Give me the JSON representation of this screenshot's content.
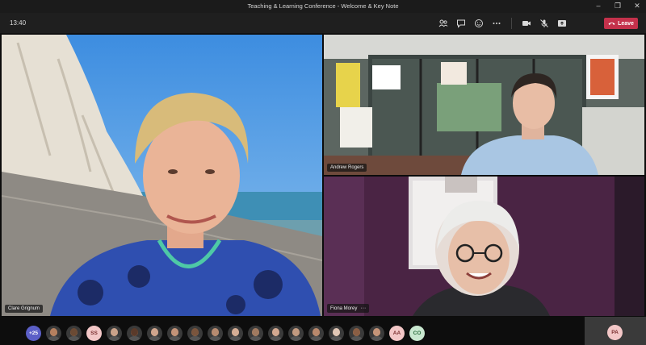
{
  "window": {
    "title": "Teaching & Learning Conference - Welcome & Key Note"
  },
  "toolbar": {
    "time": "13:40",
    "icons": [
      "people-icon",
      "chat-icon",
      "reactions-icon",
      "more-icon",
      "camera-icon",
      "mic-off-icon",
      "share-icon"
    ],
    "leave_label": "Leave"
  },
  "tiles": [
    {
      "name": "Clare Grignum"
    },
    {
      "name": "Andrew Rogers"
    },
    {
      "name": "Fiona Morey",
      "more": "···"
    }
  ],
  "strip": {
    "overflow_count": "+25",
    "participants": [
      {
        "kind": "photo",
        "tone": "#b5805f"
      },
      {
        "kind": "photo",
        "tone": "#6b4a34"
      },
      {
        "kind": "initials",
        "text": "SS"
      },
      {
        "kind": "photo",
        "tone": "#caa28a"
      },
      {
        "kind": "photo",
        "tone": "#5a3a2a"
      },
      {
        "kind": "photo",
        "tone": "#d0a58d"
      },
      {
        "kind": "photo",
        "tone": "#c39378"
      },
      {
        "kind": "photo",
        "tone": "#7a553d"
      },
      {
        "kind": "photo",
        "tone": "#b78b70"
      },
      {
        "kind": "photo",
        "tone": "#d6ae95"
      },
      {
        "kind": "photo",
        "tone": "#a07a60"
      },
      {
        "kind": "photo",
        "tone": "#d2a890"
      },
      {
        "kind": "photo",
        "tone": "#c29a80"
      },
      {
        "kind": "photo",
        "tone": "#b8886c"
      },
      {
        "kind": "photo",
        "tone": "#e0c6b5"
      },
      {
        "kind": "photo",
        "tone": "#8a5e44"
      },
      {
        "kind": "photo",
        "tone": "#c49478"
      },
      {
        "kind": "initials",
        "text": "AA"
      },
      {
        "kind": "initials",
        "text": "CO"
      }
    ],
    "self_initials": "PA"
  },
  "colors": {
    "leave": "#c4314b",
    "accent": "#5b5fc7"
  }
}
